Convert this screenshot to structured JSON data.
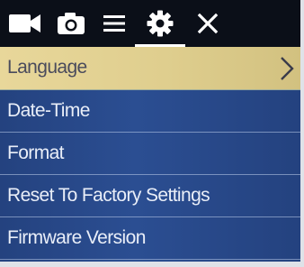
{
  "topbar": {
    "icons": [
      {
        "name": "video-camera-icon"
      },
      {
        "name": "photo-camera-icon"
      },
      {
        "name": "menu-list-icon"
      },
      {
        "name": "settings-gear-icon",
        "active": true
      },
      {
        "name": "close-icon"
      }
    ]
  },
  "menu": {
    "selected_index": 0,
    "items": [
      {
        "label": "Language",
        "has_submenu": true
      },
      {
        "label": "Date-Time"
      },
      {
        "label": "Format"
      },
      {
        "label": "Reset To Factory Settings"
      },
      {
        "label": "Firmware Version"
      }
    ]
  },
  "colors": {
    "topbar_bg": "#0b0f18",
    "menu_bg": "#2b4e92",
    "selected_bg": "#e2d293",
    "text": "#e9eef8",
    "selected_text": "#4a4b5c"
  }
}
